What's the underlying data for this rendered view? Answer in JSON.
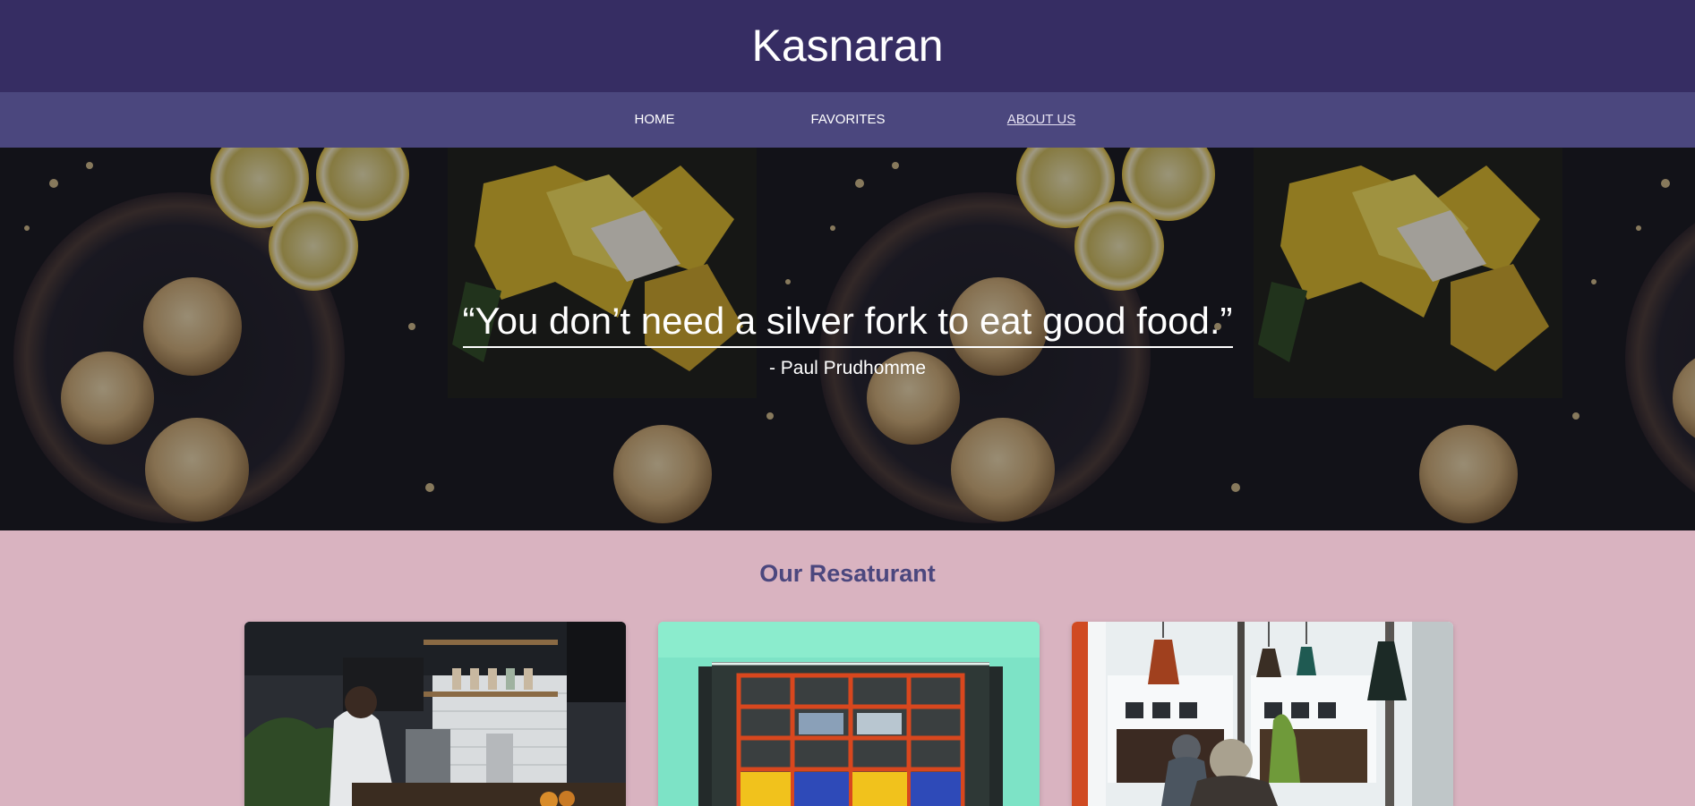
{
  "header": {
    "title": "Kasnaran"
  },
  "nav": {
    "items": [
      {
        "label": "HOME",
        "active": false
      },
      {
        "label": "FAVORITES",
        "active": false
      },
      {
        "label": "ABOUT US",
        "active": true
      }
    ]
  },
  "hero": {
    "quote": "“You don’t need a silver fork to eat good food.”",
    "author": "- Paul Prudhomme"
  },
  "restaurant": {
    "heading": "Our Resaturant",
    "cards": [
      {
        "image": "kitchen-counter-photo"
      },
      {
        "image": "colorful-storefront-photo"
      },
      {
        "image": "cafe-pendant-lamps-photo"
      }
    ]
  },
  "colors": {
    "header_bg": "#362d63",
    "nav_bg": "#4b477e",
    "page_bg": "#d9b3c0",
    "heading": "#4b477e"
  }
}
